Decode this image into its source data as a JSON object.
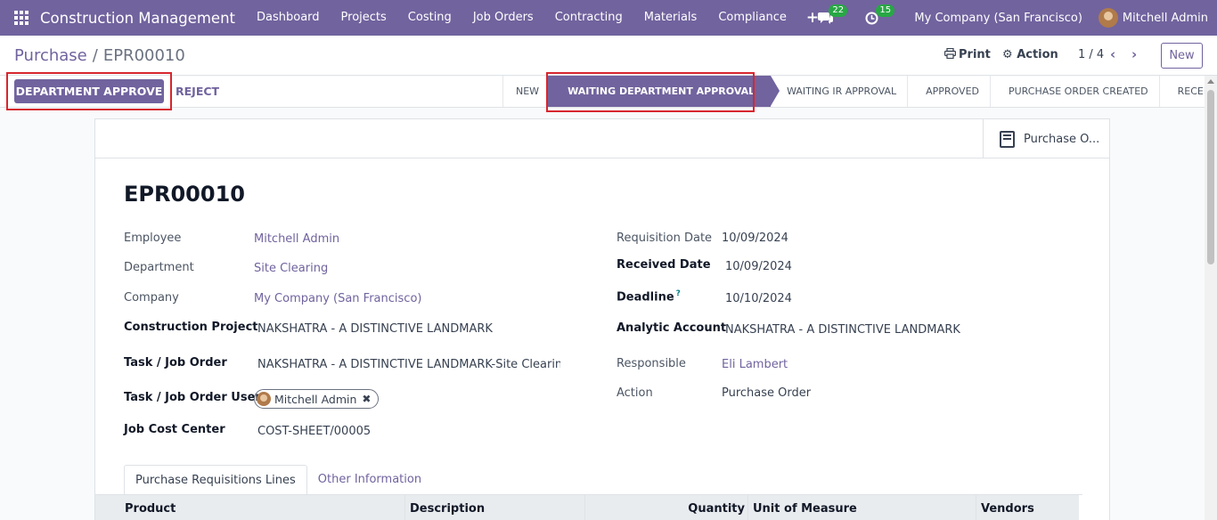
{
  "navbar": {
    "brand": "Construction Management",
    "menu": [
      "Dashboard",
      "Projects",
      "Costing",
      "Job Orders",
      "Contracting",
      "Materials",
      "Compliance"
    ],
    "plus": "+",
    "chat_badge": "22",
    "activity_badge": "15",
    "company": "My Company (San Francisco)",
    "user": "Mitchell Admin",
    "accent_color": "#71639e"
  },
  "control_panel": {
    "breadcrumb_parent": "Purchase",
    "breadcrumb_sep": "/",
    "breadcrumb_current": "EPR00010",
    "print_label": "Print",
    "action_label": "Action",
    "pager": "1 / 4",
    "new_label": "New"
  },
  "status_bar": {
    "approve_label": "DEPARTMENT APPROVE",
    "reject_label": "REJECT",
    "stages": [
      "NEW",
      "WAITING DEPARTMENT APPROVAL",
      "WAITING IR APPROVAL",
      "APPROVED",
      "PURCHASE ORDER CREATED",
      "RECEIVED"
    ],
    "active_stage": "WAITING DEPARTMENT APPROVAL"
  },
  "smart_button": {
    "label": "Purchase O..."
  },
  "form": {
    "title": "EPR00010",
    "left": {
      "employee_label": "Employee",
      "employee": "Mitchell Admin",
      "department_label": "Department",
      "department": "Site Clearing",
      "company_label": "Company",
      "company": "My Company (San Francisco)",
      "project_label": "Construction Project",
      "project": "NAKSHATRA - A DISTINCTIVE LANDMARK",
      "task_label": "Task / Job Order",
      "task": "NAKSHATRA - A DISTINCTIVE LANDMARK-Site Clearing-Ka",
      "task_user_label": "Task / Job Order User",
      "task_user": "Mitchell Admin",
      "cost_center_label": "Job Cost Center",
      "cost_center": "COST-SHEET/00005"
    },
    "right": {
      "req_date_label": "Requisition Date",
      "req_date": "10/09/2024",
      "received_date_label": "Received Date",
      "received_date": "10/09/2024",
      "deadline_label": "Deadline",
      "deadline_help": "?",
      "deadline": "10/10/2024",
      "analytic_label": "Analytic Account",
      "analytic": "NAKSHATRA - A DISTINCTIVE LANDMARK",
      "responsible_label": "Responsible",
      "responsible": "Eli Lambert",
      "action_label": "Action",
      "action": "Purchase Order"
    },
    "tabs": [
      "Purchase Requisitions Lines",
      "Other Information"
    ],
    "table_headers": [
      "Product",
      "Description",
      "Quantity",
      "Unit of Measure",
      "Vendors"
    ]
  }
}
